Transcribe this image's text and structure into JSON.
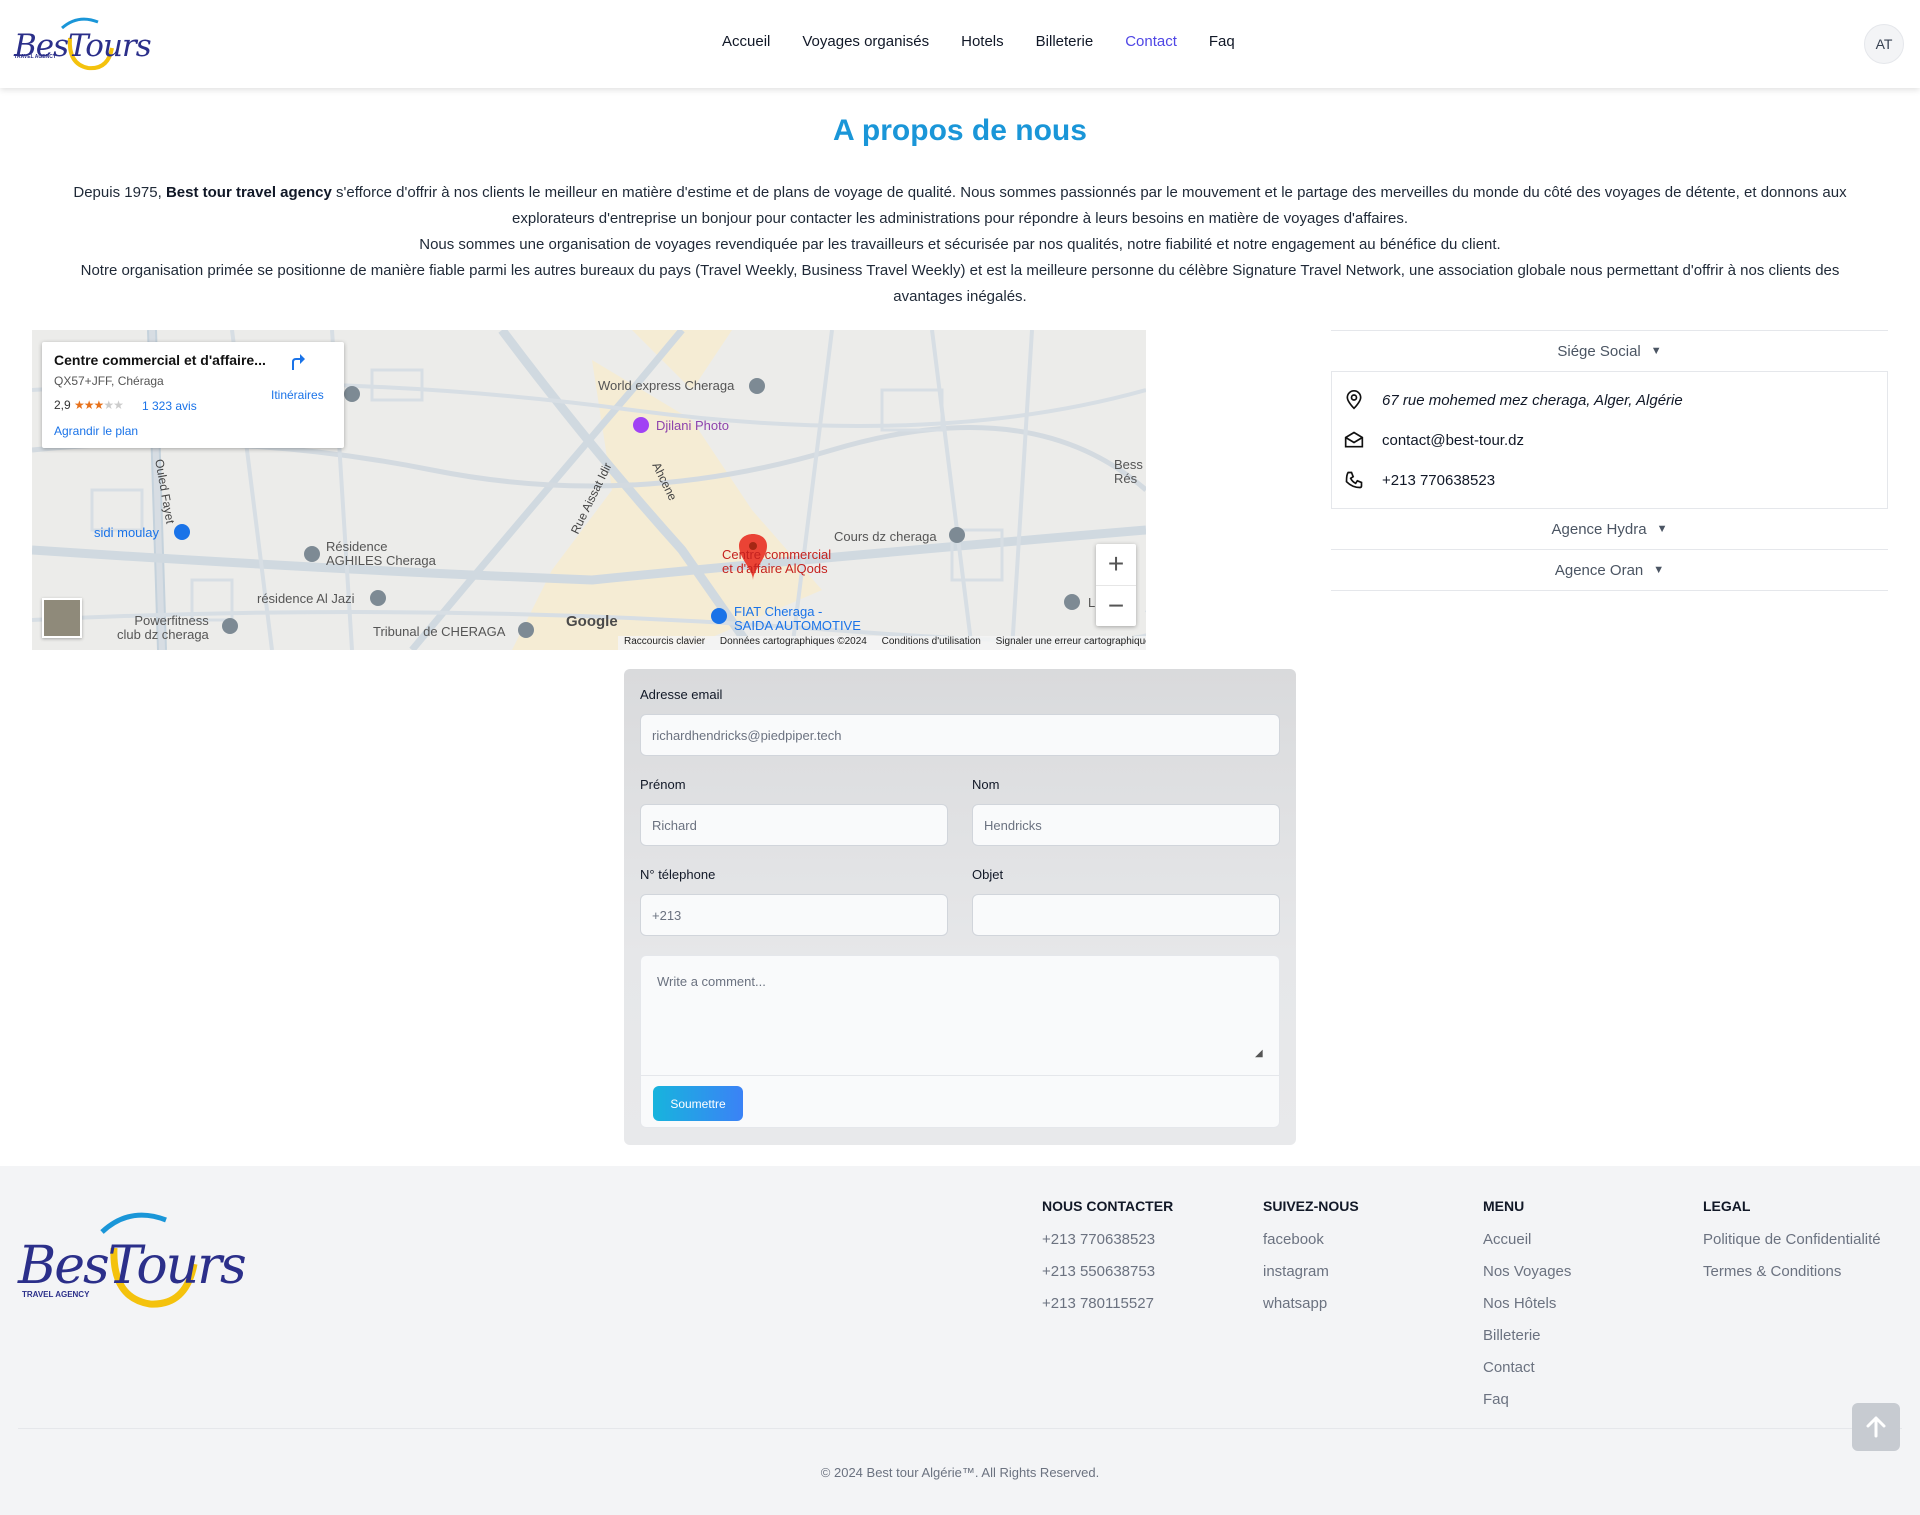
{
  "header": {
    "logo_text": "BesTours",
    "logo_sub": "TRAVEL AGENCY",
    "nav": [
      "Accueil",
      "Voyages organisés",
      "Hotels",
      "Billeterie",
      "Contact",
      "Faq"
    ],
    "active_nav": "Contact",
    "avatar": "AT"
  },
  "about": {
    "title": "A propos de nous",
    "p1_before": "Depuis 1975, ",
    "p1_bold": "Best tour travel agency",
    "p1_after": " s'efforce d'offrir à nos clients le meilleur en matière d'estime et de plans de voyage de qualité. Nous sommes passionnés par le mouvement et le partage des merveilles du monde du côté des voyages de détente, et donnons aux explorateurs d'entreprise un bonjour pour contacter les administrations pour répondre à leurs besoins en matière de voyages d'affaires.",
    "p2": "Nous sommes une organisation de voyages revendiquée par les travailleurs et sécurisée par nos qualités, notre fiabilité et notre engagement au bénéfice du client.",
    "p3": "Notre organisation primée se positionne de manière fiable parmi les autres bureaux du pays (Travel Weekly, Business Travel Weekly) et est la meilleure personne du célèbre Signature Travel Network, une association globale nous permettant d'offrir à nos clients des avantages inégalés."
  },
  "map": {
    "card_title": "Centre commercial et d'affaire...",
    "card_sub": "QX57+JFF, Chéraga",
    "rating": "2,9",
    "stars_on": "★★★",
    "stars_off": "★★",
    "reviews": "1 323 avis",
    "enlarge": "Agrandir le plan",
    "directions": "Itinéraires",
    "labels": {
      "world_express": "World express Cheraga",
      "djilani": "Djilani Photo",
      "sidi_moulay": "sidi moulay",
      "residence_1": "Résidence",
      "residence_2": "AGHILES Cheraga",
      "al_jazi": "résidence Al Jazi",
      "powerfitness_1": "Powerfitness",
      "powerfitness_2": "club dz cheraga",
      "tribunal": "Tribunal de CHERAGA",
      "cours": "Cours dz cheraga",
      "centre_1": "Centre commercial",
      "centre_2": "et d'affaire AlQods",
      "fiat_1": "FIAT Cheraga -",
      "fiat_2": "SAIDA AUTOMOTIVE",
      "bess_1": "Bess",
      "bess_2": "Rés",
      "road_fayet": "Ouled Fayet",
      "road_idir": "Rue Aissat Idir",
      "road_ahcene": "Ahcene",
      "edge_l": "L"
    },
    "zoom_in": "+",
    "zoom_out": "−",
    "google": "Google",
    "footer": [
      "Raccourcis clavier",
      "Données cartographiques ©2024",
      "Conditions d'utilisation",
      "Signaler une erreur cartographique"
    ]
  },
  "accordion": {
    "siege": "Siége Social",
    "address": "67 rue mohemed mez cheraga, Alger, Algérie",
    "email": "contact@best-tour.dz",
    "phone": "+213 770638523",
    "hydra": "Agence Hydra",
    "oran": "Agence Oran"
  },
  "form": {
    "email_label": "Adresse email",
    "email_placeholder": "richardhendricks@piedpiper.tech",
    "prenom_label": "Prénom",
    "prenom_placeholder": "Richard",
    "nom_label": "Nom",
    "nom_placeholder": "Hendricks",
    "tel_label": "N° télephone",
    "tel_placeholder": "+213",
    "objet_label": "Objet",
    "objet_placeholder": "",
    "comment_placeholder": "Write a comment...",
    "submit": "Soumettre"
  },
  "footer": {
    "logo_text": "BesTours",
    "logo_sub": "TRAVEL AGENCY",
    "contact_title": "NOUS CONTACTER",
    "phones": [
      "+213 770638523",
      "+213 550638753",
      "+213 780115527"
    ],
    "follow_title": "SUIVEZ-NOUS",
    "socials": [
      "facebook",
      "instagram",
      "whatsapp"
    ],
    "menu_title": "MENU",
    "menu": [
      "Accueil",
      "Nos Voyages",
      "Nos Hôtels",
      "Billeterie",
      "Contact",
      "Faq"
    ],
    "legal_title": "LEGAL",
    "legal": [
      "Politique de Confidentialité",
      "Termes & Conditions"
    ],
    "copyright": "© 2024 Best tour Algérie™. All Rights Reserved."
  },
  "colors": {
    "accent_blue": "#1a96d8",
    "nav_active": "#4f46e5",
    "logo_navy": "#2b2f8a",
    "logo_yellow": "#f4c20d",
    "map_pin": "#ea4335"
  },
  "icons": {
    "back_to_top": "arrow-up-icon",
    "accordion_chevron": "chevron-down-icon",
    "address": "location-pin-icon",
    "email": "envelope-icon",
    "phone": "phone-icon"
  }
}
